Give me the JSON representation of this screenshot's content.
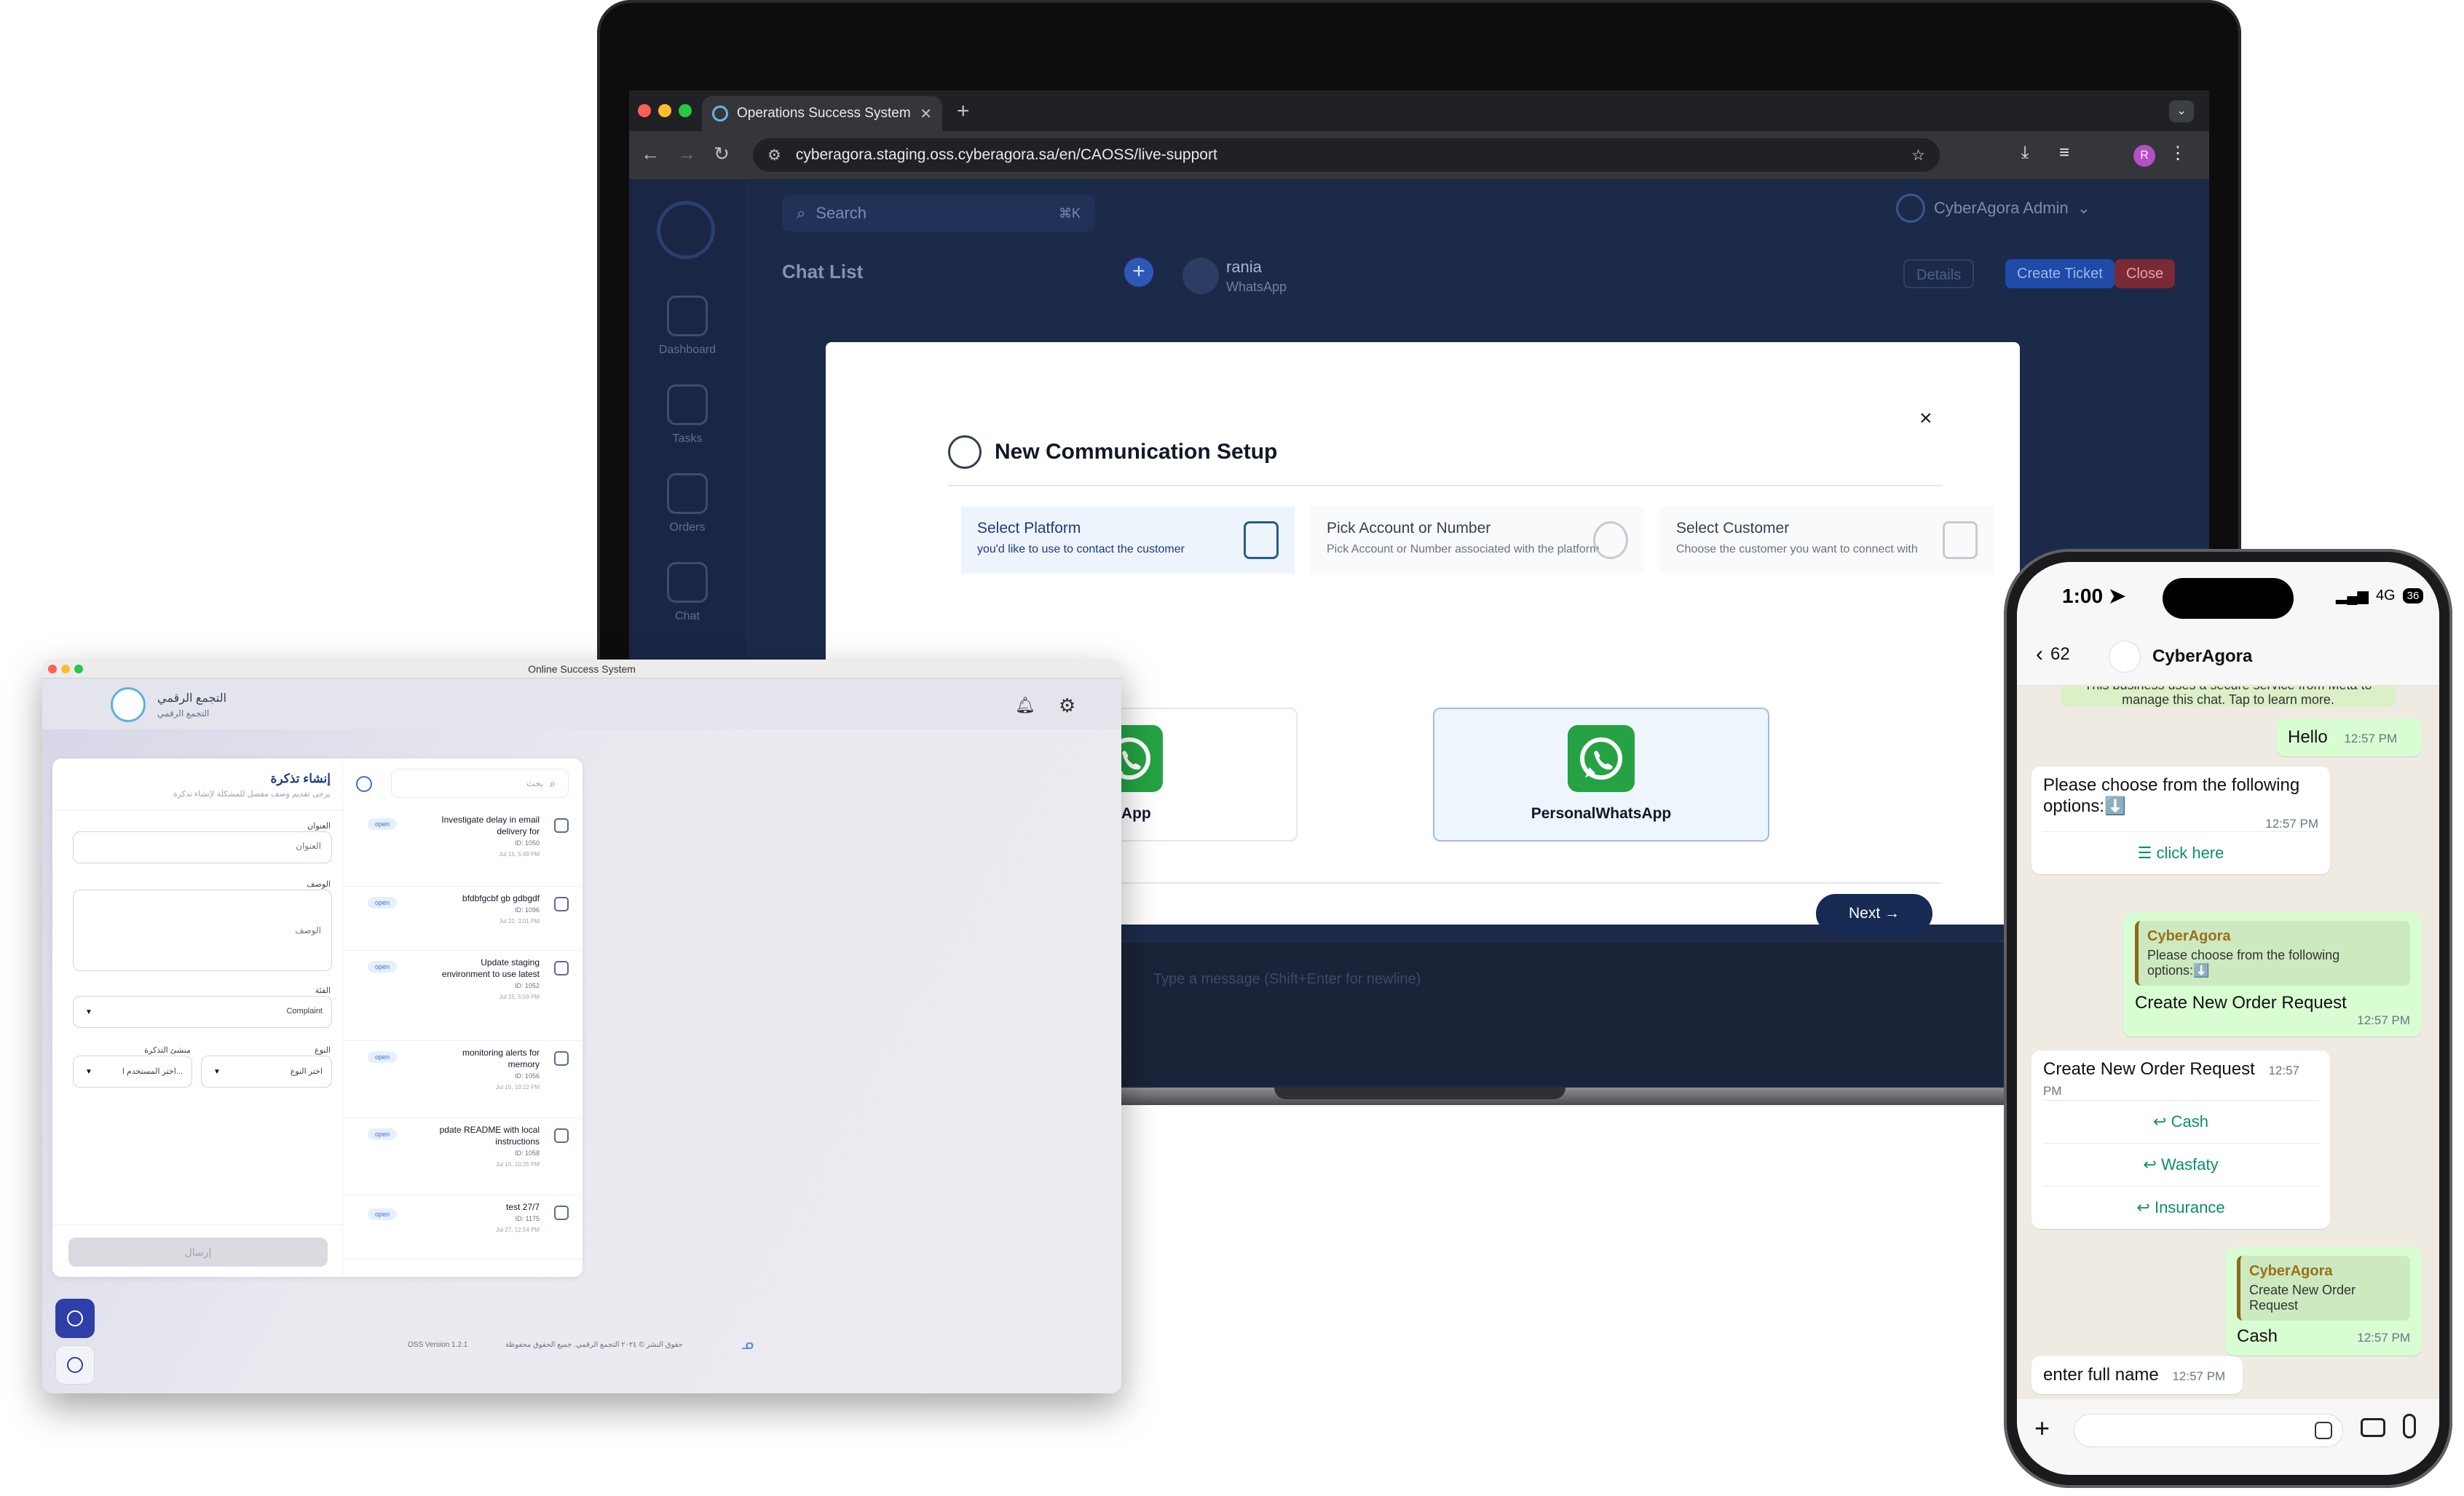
{
  "browser": {
    "tab_title": "Operations Success System",
    "url": "cyberagora.staging.oss.cyberagora.sa/en/CAOSS/live-support",
    "profile_initial": "R"
  },
  "background_app": {
    "search_placeholder": "Search",
    "search_shortcut": "⌘K",
    "admin_label": "CyberAgora Admin",
    "chat_list_title": "Chat List",
    "contact_name": "rania",
    "contact_channel": "WhatsApp",
    "details_label": "Details",
    "create_ticket_label": "Create Ticket",
    "close_label": "Close",
    "sidebar": [
      "Dashboard",
      "Tasks",
      "Orders",
      "Chat"
    ],
    "composer_placeholder": "Type a message (Shift+Enter for newline)"
  },
  "modal": {
    "title": "New Communication Setup",
    "steps": [
      {
        "title": "Select Platform",
        "desc": "you'd like to use to contact the customer"
      },
      {
        "title": "Pick Account or Number",
        "desc": "Pick Account or Number associated with the platform"
      },
      {
        "title": "Select Customer",
        "desc": "Choose the customer you want to connect with"
      }
    ],
    "platforms": [
      {
        "label": "tsApp",
        "selected": false
      },
      {
        "label": "PersonalWhatsApp",
        "selected": true
      }
    ],
    "next_label": "Next →"
  },
  "desktop_app": {
    "window_title": "Online Success System",
    "brand_name": "التجمع الرقمي",
    "brand_sub": "التجمع الرقمي",
    "form": {
      "title": "إنشاء تذكرة",
      "subtitle": "يرجى تقديم وصف مفصل للمشكلة لإنشاء تذكرة",
      "title_label": "العنوان",
      "title_placeholder": "العنوان",
      "desc_label": "الوصف",
      "desc_placeholder": "الوصف",
      "category_label": "الفئة",
      "category_value": "Complaint",
      "type_label": "النوع",
      "type_placeholder": "اختر النوع",
      "creator_label": "منشئ التذكرة",
      "creator_placeholder": "اختر المستخدم ا...",
      "submit_label": "إرسال"
    },
    "list": {
      "search_placeholder": "بحث",
      "tickets": [
        {
          "status": "open",
          "title": "Investigate delay in email delivery for",
          "id": "ID: 1050",
          "date": "Jul 15, 5:49 PM"
        },
        {
          "status": "open",
          "title": "bfdbfgcbf gb gdbgdf",
          "id": "ID: 1096",
          "date": "Jul 22, 3:01 PM"
        },
        {
          "status": "open",
          "title": "Update staging environment to use latest",
          "id": "ID: 1052",
          "date": "Jul 15, 5:59 PM"
        },
        {
          "status": "open",
          "title": "monitoring alerts for memory",
          "id": "ID: 1056",
          "date": "Jul 15, 10:12 PM"
        },
        {
          "status": "open",
          "title": "pdate README with local instructions",
          "id": "ID: 1058",
          "date": "Jul 15, 10:25 PM"
        },
        {
          "status": "open",
          "title": "test 27/7",
          "id": "ID: 1175",
          "date": "Jul 27, 12:54 PM"
        }
      ]
    },
    "footer_copyright": "حقوق النشر © ٢٠٢٤ التجمع الرقمي. جميع الحقوق محفوظة",
    "footer_version": "OSS Version 1.2.1"
  },
  "phone": {
    "time": "1:00",
    "network": "4G",
    "battery": "36",
    "back_count": "62",
    "contact_name": "CyberAgora",
    "notice": "This business uses a secure service from Meta to manage this chat. Tap to learn more.",
    "messages": [
      {
        "dir": "out",
        "text": "Hello",
        "time": "12:57 PM"
      },
      {
        "dir": "in",
        "text": "Please choose from the following options:⬇️",
        "time": "12:57 PM",
        "button": "click here"
      },
      {
        "dir": "out",
        "quote_name": "CyberAgora",
        "quote_text": "Please choose from the following options:⬇️",
        "text": "Create New Order Request",
        "time": "12:57 PM"
      },
      {
        "dir": "in",
        "text": "Create New Order Request",
        "time": "12:57 PM",
        "replies": [
          "Cash",
          "Wasfaty",
          "Insurance"
        ]
      },
      {
        "dir": "out",
        "quote_name": "CyberAgora",
        "quote_text": "Create New Order Request",
        "text": "Cash",
        "time": "12:57 PM"
      },
      {
        "dir": "in",
        "text": "enter full name",
        "time": "12:57 PM"
      }
    ]
  },
  "colors": {
    "whatsapp_green": "#25a244",
    "primary_navy": "#162a54",
    "app_dark": "#1c2a4a"
  }
}
